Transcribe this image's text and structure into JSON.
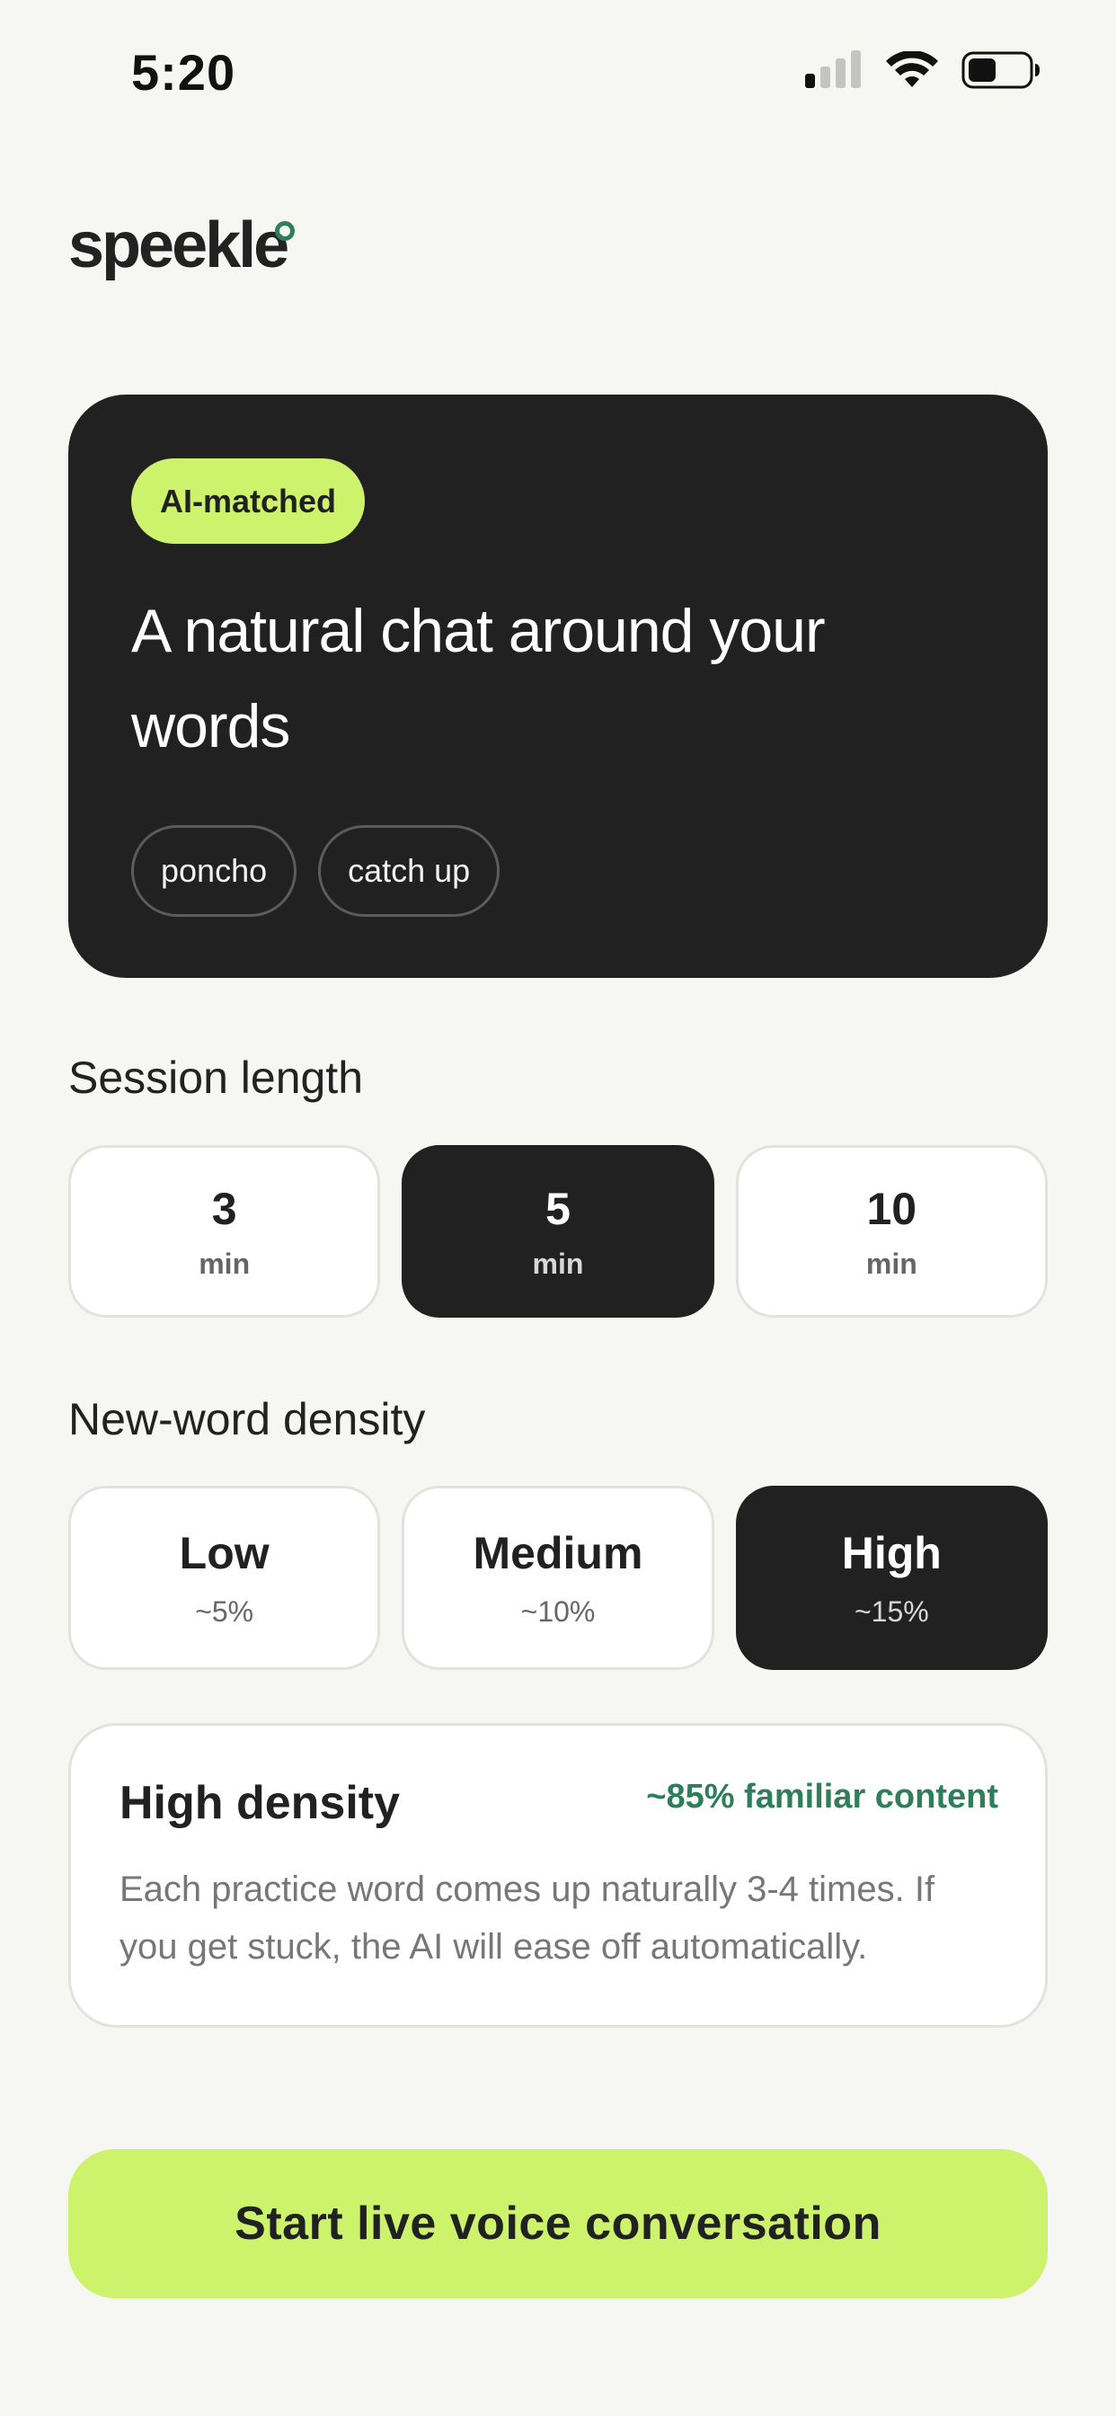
{
  "status_bar": {
    "time": "5:20",
    "icons": [
      "cellular-signal-icon",
      "wifi-icon",
      "battery-icon"
    ]
  },
  "brand": {
    "name": "speekle",
    "accent_color": "#2e7d5b"
  },
  "hero": {
    "badge": "AI-matched",
    "title": "A natural chat around your words",
    "words": [
      "poncho",
      "catch up"
    ],
    "background": "#212121",
    "badge_color": "#cdf26b"
  },
  "session_length": {
    "label": "Session length",
    "options": [
      {
        "value": "3",
        "unit": "min"
      },
      {
        "value": "5",
        "unit": "min"
      },
      {
        "value": "10",
        "unit": "min"
      }
    ],
    "selected": "5"
  },
  "density": {
    "label": "New-word density",
    "options": [
      {
        "name": "Low",
        "pct": "~5%"
      },
      {
        "name": "Medium",
        "pct": "~10%"
      },
      {
        "name": "High",
        "pct": "~15%"
      }
    ],
    "selected": "High"
  },
  "info": {
    "title": "High density",
    "familiar": "~85% familiar content",
    "body": "Each practice word comes up naturally 3-4 times. If you get stuck, the AI will ease off automatically."
  },
  "cta": {
    "label": "Start live voice conversation",
    "color": "#cdf26b"
  }
}
